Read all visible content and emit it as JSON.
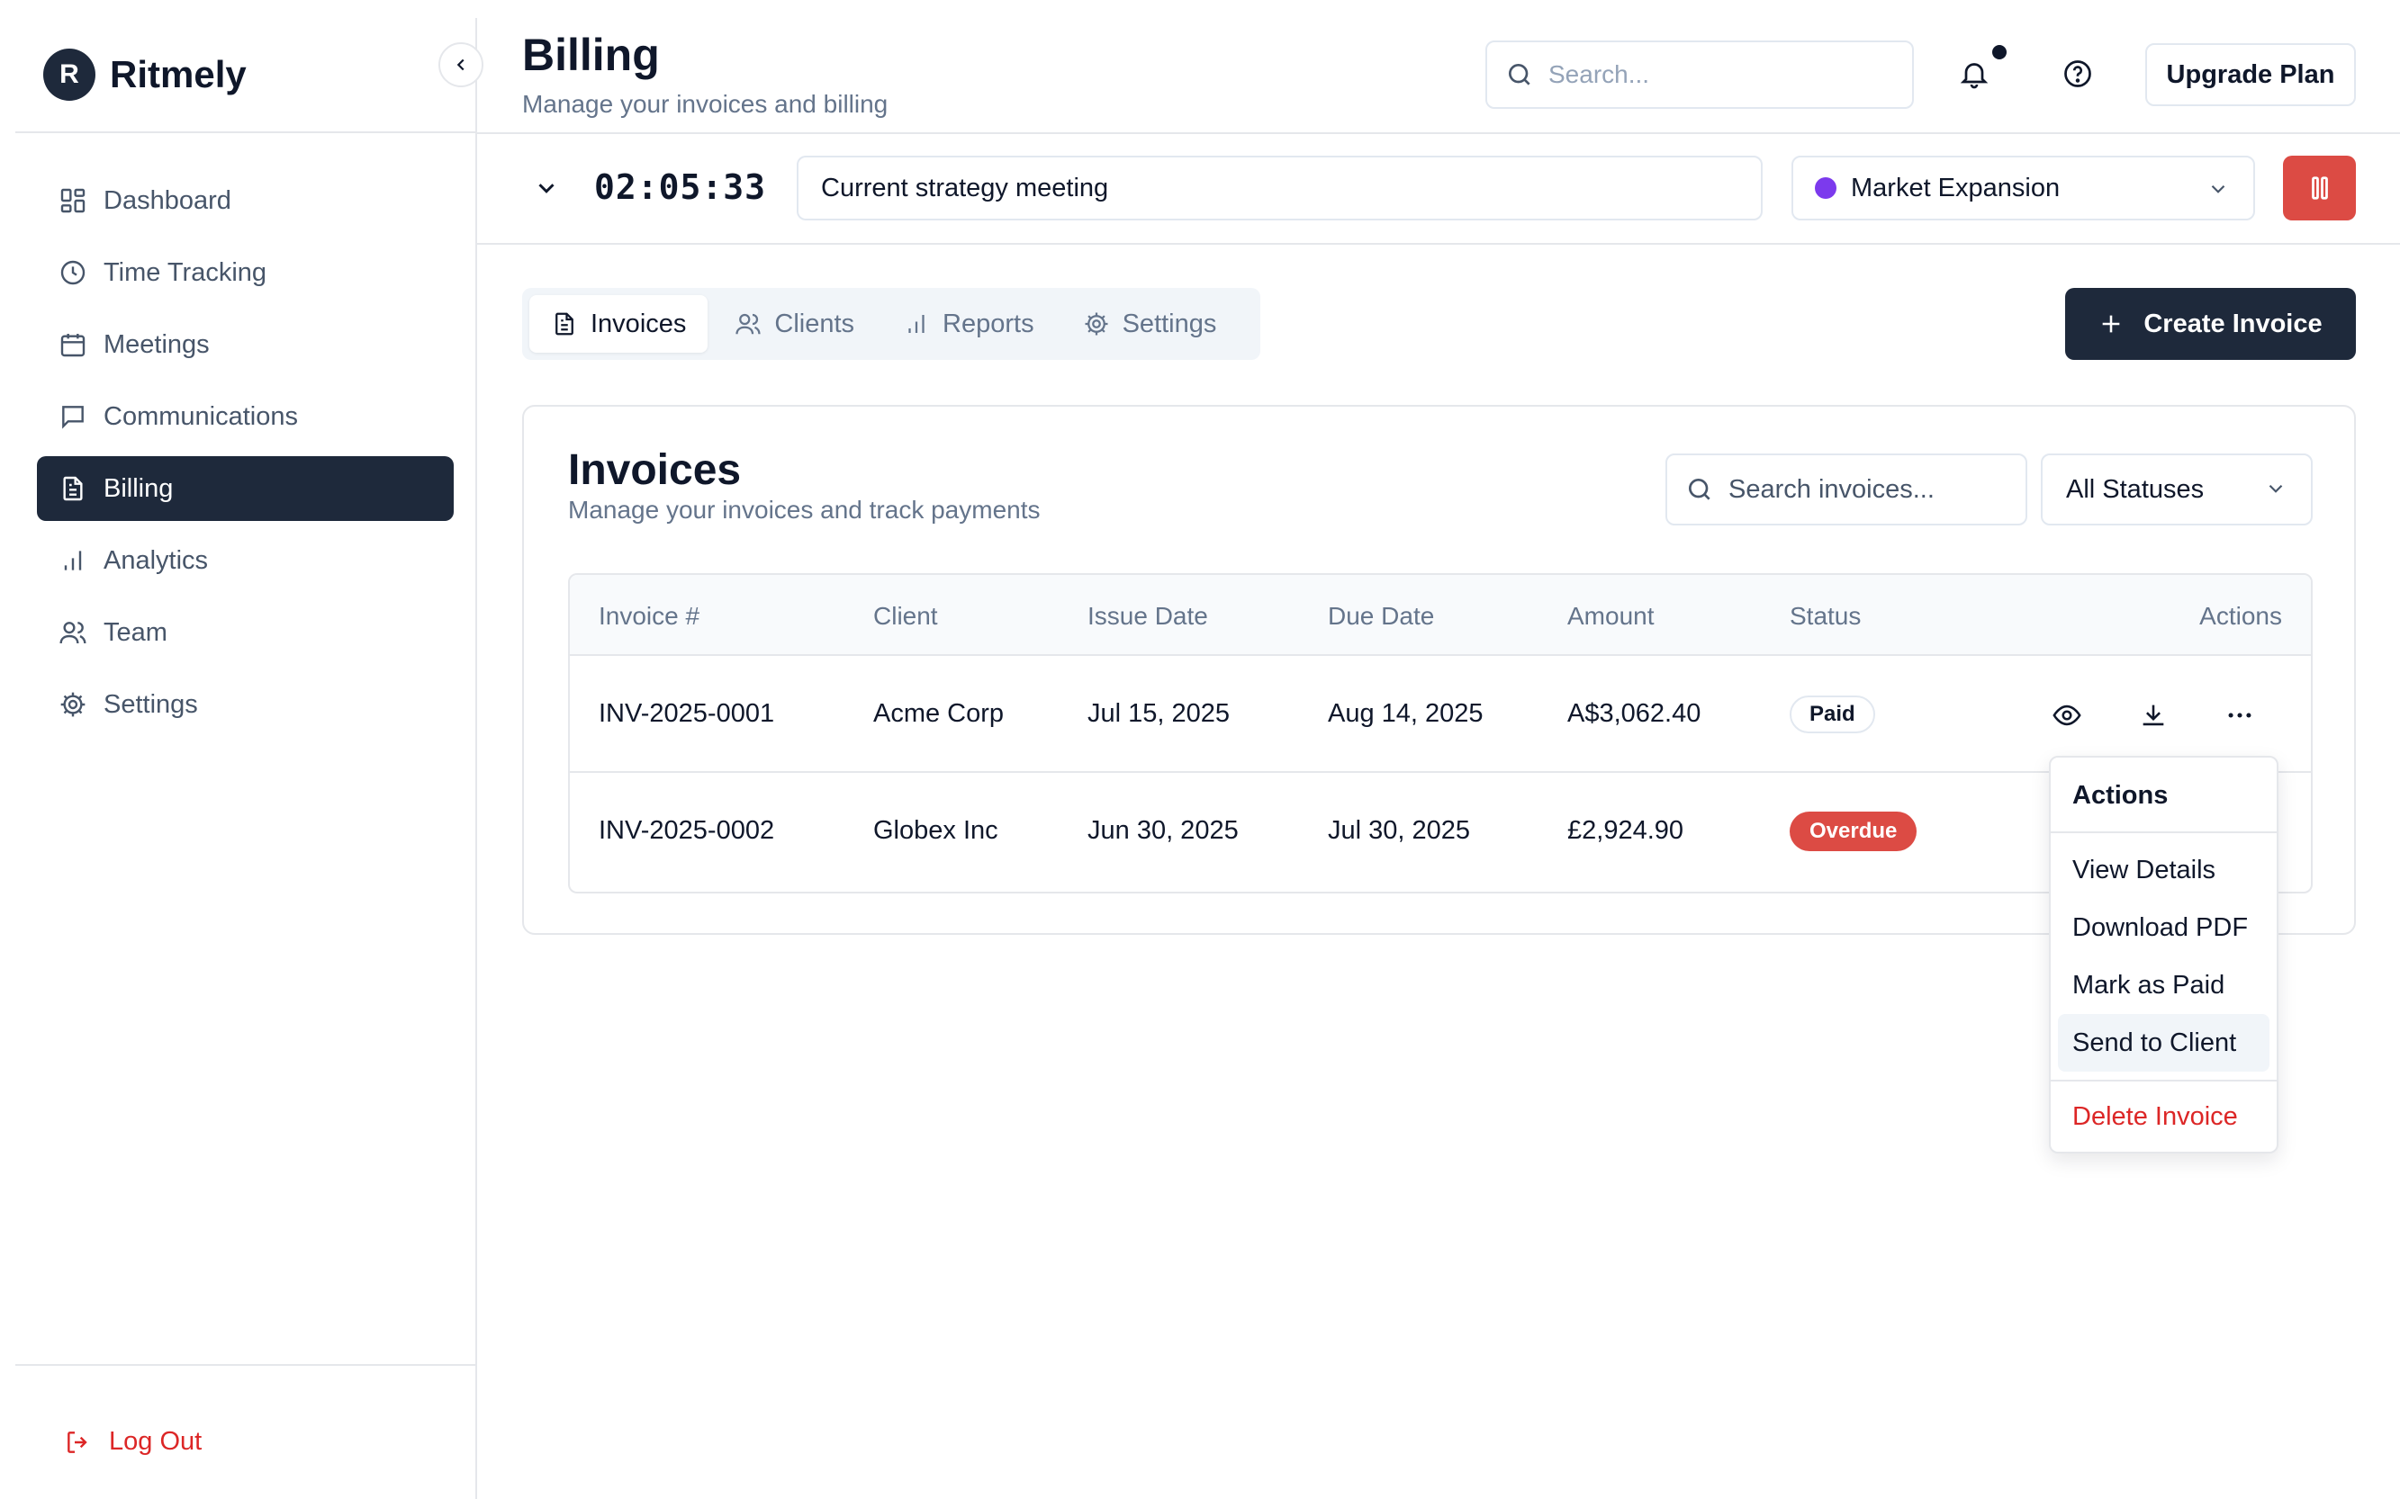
{
  "app": {
    "logo_letter": "R",
    "name": "Ritmely"
  },
  "sidebar": {
    "items": [
      {
        "label": "Dashboard",
        "icon": "dashboard-icon"
      },
      {
        "label": "Time Tracking",
        "icon": "clock-icon"
      },
      {
        "label": "Meetings",
        "icon": "calendar-icon"
      },
      {
        "label": "Communications",
        "icon": "message-icon"
      },
      {
        "label": "Billing",
        "icon": "file-text-icon",
        "active": true
      },
      {
        "label": "Analytics",
        "icon": "bar-chart-icon"
      },
      {
        "label": "Team",
        "icon": "users-icon"
      },
      {
        "label": "Settings",
        "icon": "gear-icon"
      }
    ],
    "logout_label": "Log Out"
  },
  "header": {
    "title": "Billing",
    "subtitle": "Manage your invoices and billing",
    "search_placeholder": "Search...",
    "upgrade_label": "Upgrade Plan"
  },
  "timer": {
    "time": "02:05:33",
    "task": "Current strategy meeting",
    "project": "Market Expansion",
    "project_color": "#7c3aed",
    "stop_color": "#dc4b44"
  },
  "tabs": [
    {
      "label": "Invoices",
      "icon": "file-text-icon",
      "active": true
    },
    {
      "label": "Clients",
      "icon": "users-icon"
    },
    {
      "label": "Reports",
      "icon": "bar-chart-icon"
    },
    {
      "label": "Settings",
      "icon": "gear-icon"
    }
  ],
  "create_invoice_label": "Create Invoice",
  "invoices_card": {
    "title": "Invoices",
    "subtitle": "Manage your invoices and track payments",
    "search_placeholder": "Search invoices...",
    "status_filter": "All Statuses",
    "columns": [
      "Invoice #",
      "Client",
      "Issue Date",
      "Due Date",
      "Amount",
      "Status",
      "Actions"
    ],
    "rows": [
      {
        "invoice": "INV-2025-0001",
        "client": "Acme Corp",
        "issue_date": "Jul 15, 2025",
        "due_date": "Aug 14, 2025",
        "amount": "A$3,062.40",
        "status": "Paid"
      },
      {
        "invoice": "INV-2025-0002",
        "client": "Globex Inc",
        "issue_date": "Jun 30, 2025",
        "due_date": "Jul 30, 2025",
        "amount": "£2,924.90",
        "status": "Overdue"
      }
    ]
  },
  "actions_menu": {
    "label": "Actions",
    "items": [
      "View Details",
      "Download PDF",
      "Mark as Paid",
      "Send to Client"
    ],
    "danger_item": "Delete Invoice",
    "hovered_item": "Send to Client"
  }
}
